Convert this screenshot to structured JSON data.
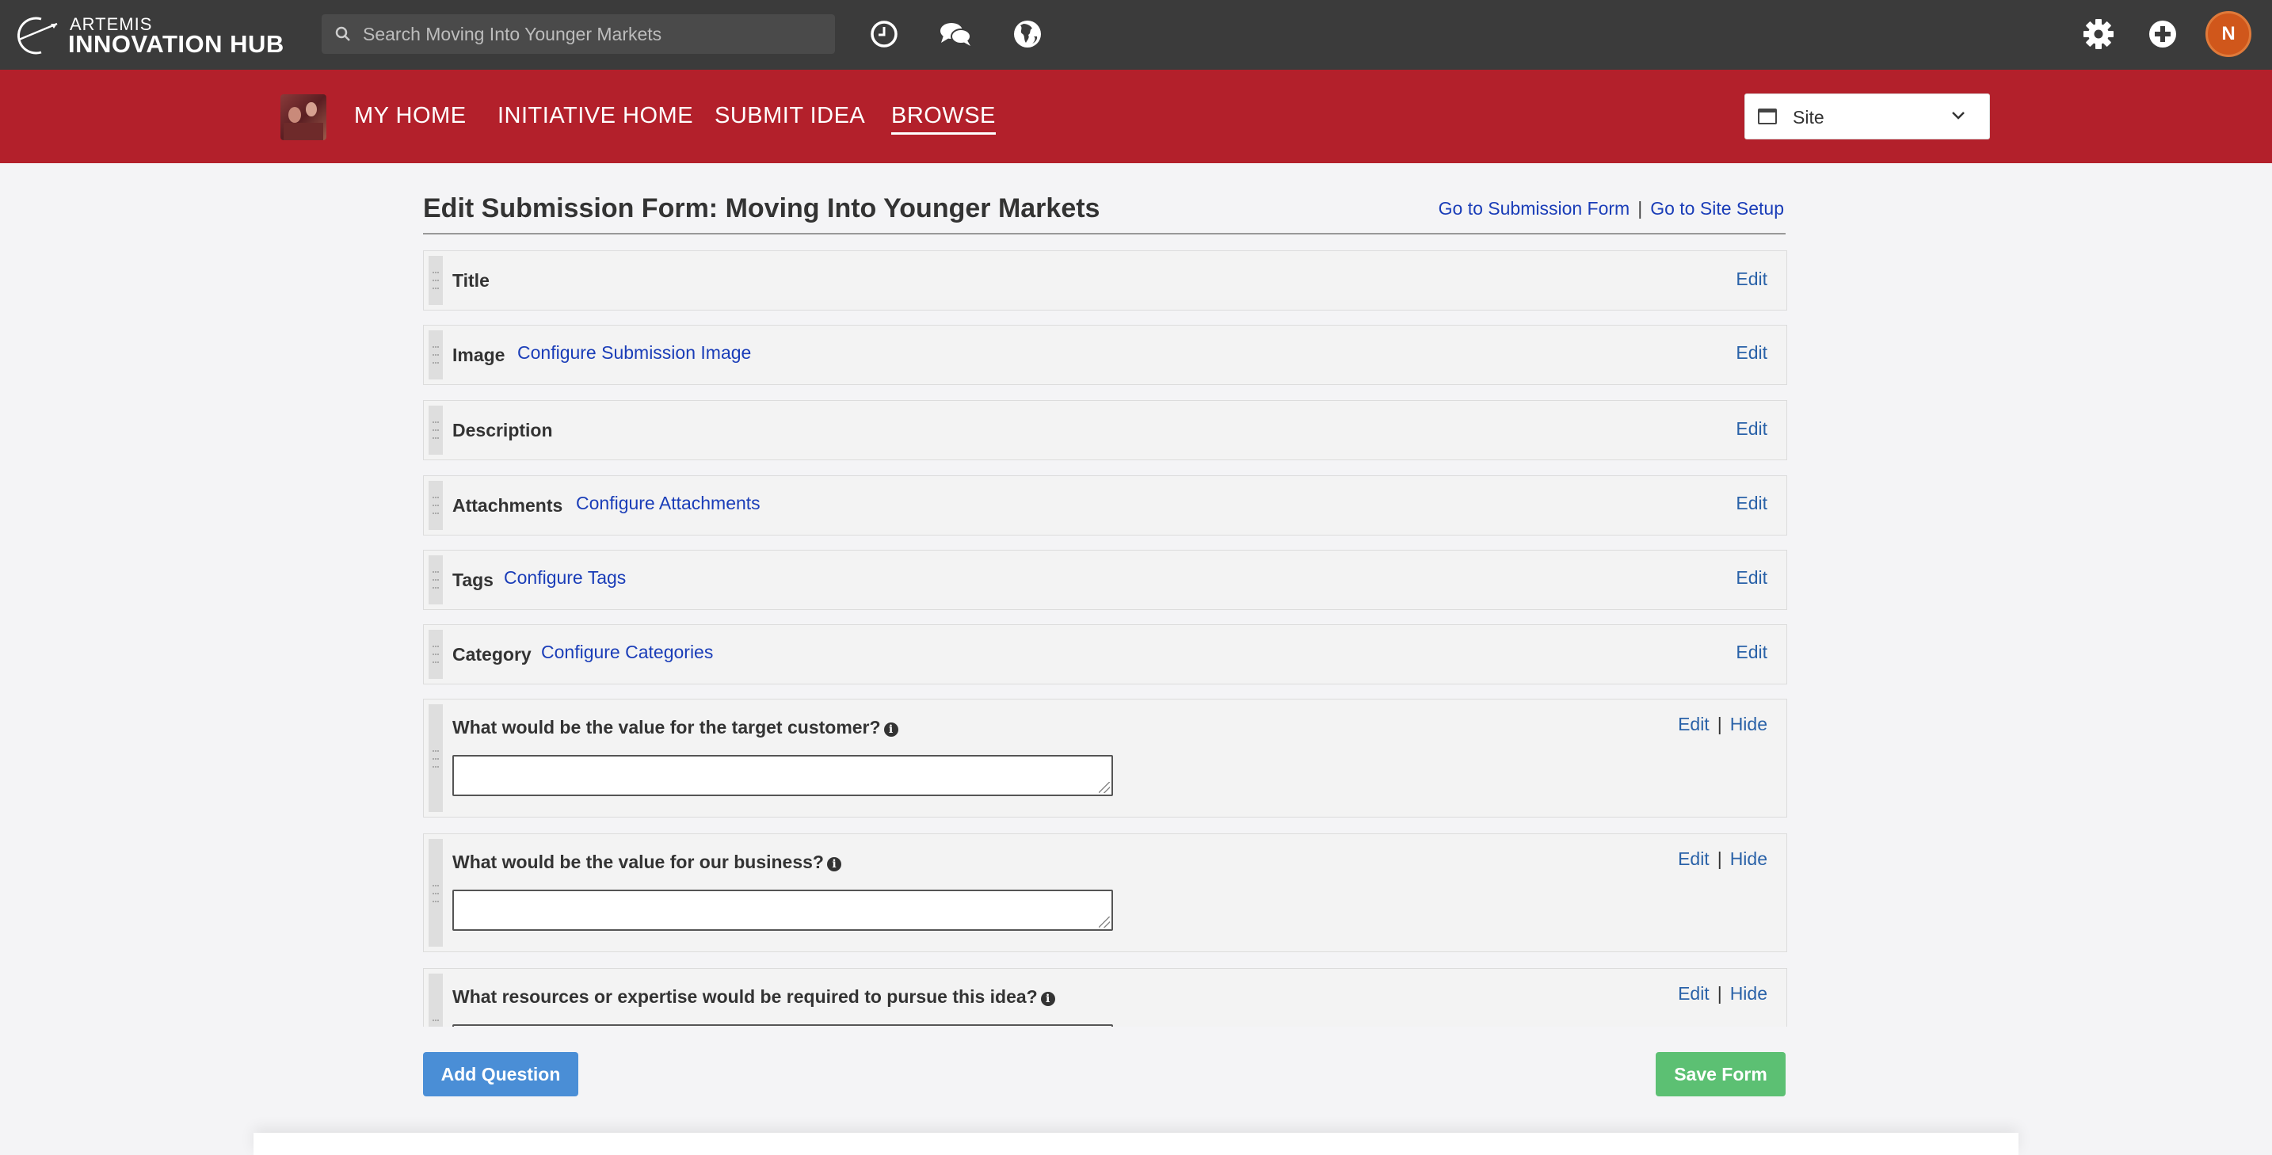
{
  "app": {
    "logo_small": "ARTEMIS",
    "logo_big": "INNOVATION HUB"
  },
  "search": {
    "placeholder": "Search Moving Into Younger Markets"
  },
  "topbar_icons": [
    "clock-icon",
    "chat-icon",
    "globe-icon",
    "gear-icon",
    "plus-circle-icon"
  ],
  "user": {
    "initial": "N",
    "avatar_color": "#d0571b"
  },
  "nav": {
    "links": [
      "MY HOME",
      "INITIATIVE HOME",
      "SUBMIT IDEA",
      "BROWSE"
    ],
    "active": "BROWSE",
    "site_select": "Site",
    "bar_color": "#b3202b"
  },
  "page": {
    "title": "Edit Submission Form: Moving Into Younger Markets",
    "link_submission_form": "Go to Submission Form",
    "link_site_setup": "Go to Site Setup",
    "separator": "|"
  },
  "fields": [
    {
      "label": "Title",
      "link": "",
      "edit": "Edit"
    },
    {
      "label": "Image",
      "link": "Configure Submission Image",
      "edit": "Edit"
    },
    {
      "label": "Description",
      "link": "",
      "edit": "Edit"
    },
    {
      "label": "Attachments",
      "link": "Configure Attachments",
      "edit": "Edit"
    },
    {
      "label": "Tags",
      "link": "Configure Tags",
      "edit": "Edit"
    },
    {
      "label": "Category",
      "link": "Configure Categories",
      "edit": "Edit"
    }
  ],
  "questions": [
    {
      "label": "What would be the value for the target customer?",
      "edit": "Edit",
      "hide": "Hide"
    },
    {
      "label": "What would be the value for our business?",
      "edit": "Edit",
      "hide": "Hide"
    },
    {
      "label": "What resources or expertise would be required to pursue this idea?",
      "edit": "Edit",
      "hide": "Hide"
    }
  ],
  "buttons": {
    "add_question": "Add Question",
    "save_form": "Save Form",
    "add_color": "#4a8ed6",
    "save_color": "#5cc073"
  }
}
